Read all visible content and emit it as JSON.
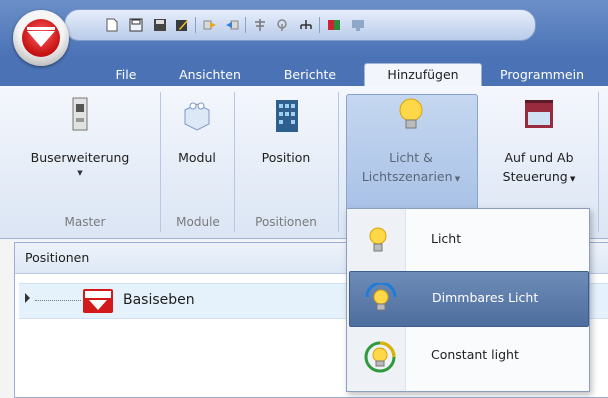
{
  "qat": {
    "icons": [
      "new-doc-icon",
      "save-icon",
      "save-as-icon",
      "edit-icon",
      "forward-icon",
      "back-icon",
      "antenna-icon",
      "radio-icon",
      "network-icon",
      "color-icon",
      "monitor-icon"
    ]
  },
  "tabs": [
    "File",
    "Ansichten",
    "Berichte",
    "Hinzufügen",
    "Programmein"
  ],
  "active_tab": "Hinzufügen",
  "ribbon": {
    "buttons": {
      "buserweiterung": "Buserweiterung",
      "modul": "Modul",
      "position": "Position",
      "licht_line1": "Licht &",
      "licht_line2": "Lichtszenarien",
      "auf_line1": "Auf und Ab",
      "auf_line2": "Steuerung"
    },
    "groups": {
      "master": "Master",
      "module": "Module",
      "positionen": "Positionen"
    }
  },
  "pane": {
    "title": "Positionen",
    "tree_item": "Basiseben"
  },
  "dropdown": {
    "items": [
      {
        "label": "Licht",
        "icon": "bulb-icon"
      },
      {
        "label": "Dimmbares Licht",
        "icon": "dimmable-bulb-icon"
      },
      {
        "label": "Constant light",
        "icon": "constant-light-icon"
      }
    ],
    "highlighted": "Dimmbares Licht"
  },
  "colors": {
    "accent": "#4a72b5",
    "highlight": "#5a79a8",
    "brand_red": "#d01818"
  }
}
